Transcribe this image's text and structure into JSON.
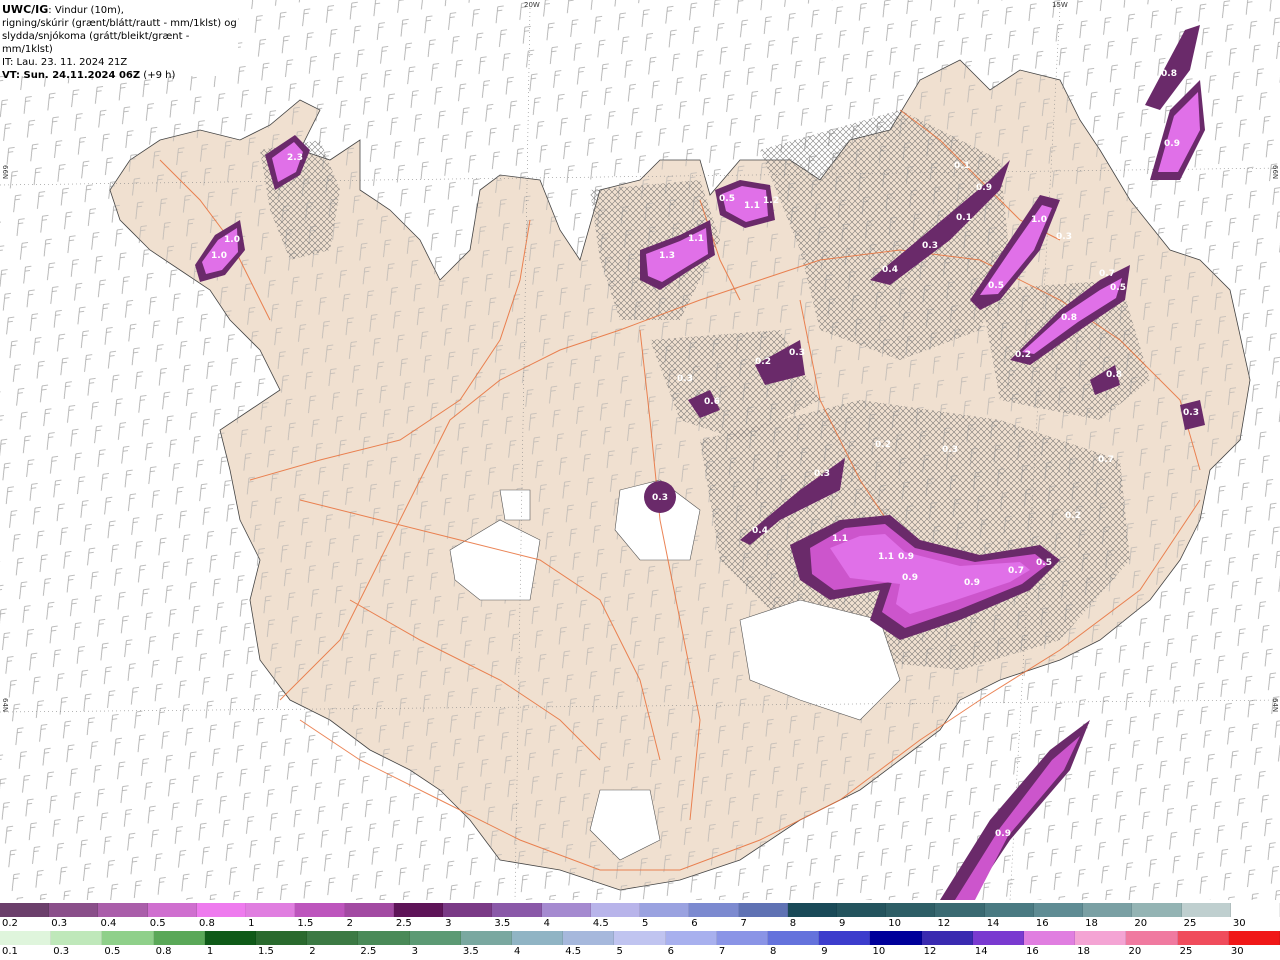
{
  "header": {
    "model": "UWC/IG",
    "line1_rest": ": Vindur (10m),",
    "line2": "rigning/skúrir (grænt/blátt/rautt - mm/1klst) og",
    "line3": "slydda/snjókoma (grátt/bleikt/grænt - mm/1klst)",
    "it": "IT: Lau. 23. 11. 2024 21Z",
    "vt_main": "VT: Sun. 24.11.2024 06Z",
    "vt_lead": " (+9 h)"
  },
  "grid_labels": {
    "lon_20w": "20W",
    "lon_15w": "15W",
    "lat_66n_left": "66N",
    "lat_66n_right": "66N",
    "lat_64n_left": "64N",
    "lat_64n_right": "64N"
  },
  "colors": {
    "land": "#f0e0d0",
    "sea": "#ffffff",
    "roads": "#e8703a",
    "glacier": "#ffffff",
    "snow_light": "#cc55cc",
    "snow_mid": "#e070e8",
    "snow_dark": "#6a2a6a"
  },
  "precip_labels": [
    {
      "text": "2.3"
    },
    {
      "text": "1.0"
    },
    {
      "text": "1.0"
    },
    {
      "text": "1.3"
    },
    {
      "text": "1.1"
    },
    {
      "text": "0.5"
    },
    {
      "text": "1.1"
    },
    {
      "text": "1.2"
    },
    {
      "text": "0.1"
    },
    {
      "text": "0.9"
    },
    {
      "text": "0.1"
    },
    {
      "text": "0.3"
    },
    {
      "text": "1.0"
    },
    {
      "text": "0.3"
    },
    {
      "text": "0.5"
    },
    {
      "text": "0.4"
    },
    {
      "text": "0.7"
    },
    {
      "text": "0.5"
    },
    {
      "text": "0.8"
    },
    {
      "text": "0.2"
    },
    {
      "text": "0.8"
    },
    {
      "text": "0.9"
    },
    {
      "text": "0.8"
    },
    {
      "text": "0.2"
    },
    {
      "text": "0.3"
    },
    {
      "text": "0.3"
    },
    {
      "text": "0.6"
    },
    {
      "text": "0.3"
    },
    {
      "text": "0.2"
    },
    {
      "text": "0.7"
    },
    {
      "text": "0.3"
    },
    {
      "text": "0.3"
    },
    {
      "text": "0.4"
    },
    {
      "text": "1.1"
    },
    {
      "text": "1.1"
    },
    {
      "text": "0.9"
    },
    {
      "text": "0.9"
    },
    {
      "text": "0.9"
    },
    {
      "text": "0.7"
    },
    {
      "text": "0.5"
    },
    {
      "text": "0.2"
    },
    {
      "text": "0.3"
    },
    {
      "text": "0.9"
    }
  ],
  "colorbar_snow": {
    "ticks": [
      "0.2",
      "0.3",
      "0.4",
      "0.5",
      "0.8",
      "1",
      "1.5",
      "2",
      "2.5",
      "3",
      "3.5",
      "4",
      "4.5",
      "5",
      "6",
      "7",
      "8",
      "9",
      "10",
      "12",
      "14",
      "16",
      "18",
      "20",
      "25",
      "30"
    ],
    "colors": [
      "#6b3f6b",
      "#8a4f8a",
      "#aa5eaa",
      "#cf6fcf",
      "#ee7bee",
      "#e07ee0",
      "#bd55bd",
      "#a24aa2",
      "#5e1458",
      "#7a3a86",
      "#8a58a8",
      "#a58ad0",
      "#b8b4ea",
      "#9aa2e0",
      "#7c8ad0",
      "#5f72b4",
      "#1a4a58",
      "#24545e",
      "#2e5e66",
      "#3a6a72",
      "#4a7a82",
      "#5f8c94",
      "#7aa0a4",
      "#94b4b4",
      "#bfcfcf",
      "#ffffff"
    ]
  },
  "colorbar_rain": {
    "ticks": [
      "0.1",
      "0.3",
      "0.5",
      "0.8",
      "1",
      "1.5",
      "2",
      "2.5",
      "3",
      "3.5",
      "4",
      "4.5",
      "5",
      "6",
      "7",
      "8",
      "9",
      "10",
      "12",
      "14",
      "16",
      "18",
      "20",
      "25",
      "30"
    ],
    "colors": [
      "#dff5dc",
      "#bfe8ba",
      "#8fd08a",
      "#5aa858",
      "#0f5a18",
      "#2a6a2e",
      "#3c7a44",
      "#4a8a58",
      "#5c9a74",
      "#7aa8a0",
      "#90b4c4",
      "#a6b8dc",
      "#c0c4f0",
      "#a8b0ee",
      "#8a94e6",
      "#6472dc",
      "#3c3ccc",
      "#00009a",
      "#3a2ab0",
      "#7a3ad0",
      "#e07ee0",
      "#f4a4d4",
      "#f07aa0",
      "#f04c5c",
      "#f01818"
    ]
  }
}
